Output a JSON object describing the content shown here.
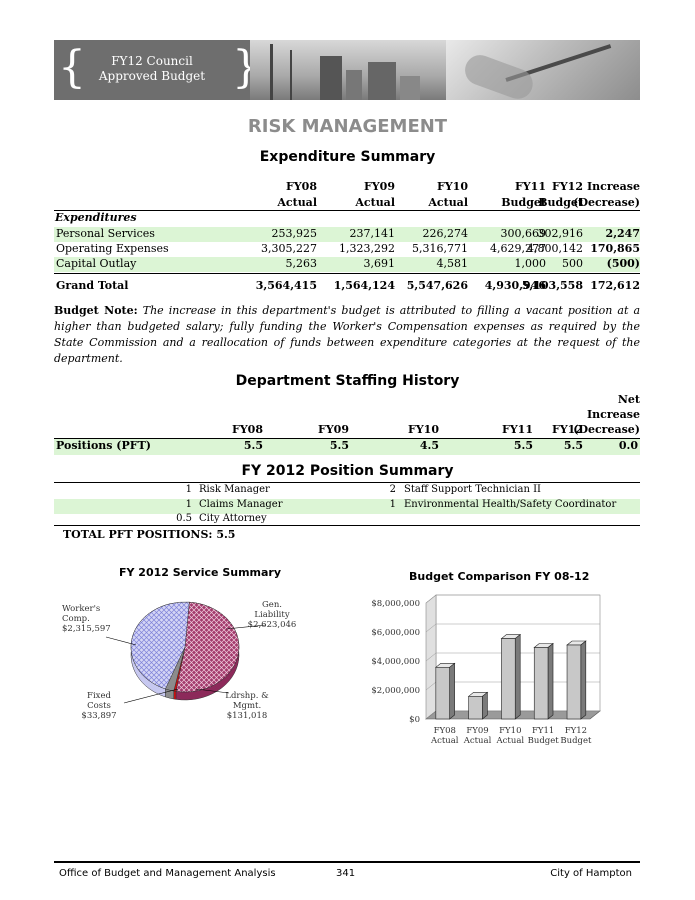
{
  "banner": {
    "line1": "FY12 Council",
    "line2": "Approved Budget"
  },
  "title": "RISK MANAGEMENT",
  "expenditure": {
    "heading": "Expenditure Summary",
    "columns": [
      {
        "line1": "FY08",
        "line2": "Actual"
      },
      {
        "line1": "FY09",
        "line2": "Actual"
      },
      {
        "line1": "FY10",
        "line2": "Actual"
      },
      {
        "line1": "FY11",
        "line2": "Budget"
      },
      {
        "line1": "FY12",
        "line2": "Budget"
      },
      {
        "line1": "Increase",
        "line2": "(Decrease)"
      }
    ],
    "section_label": "Expenditures",
    "rows": [
      {
        "label": "Personal Services",
        "values": [
          "253,925",
          "237,141",
          "226,274",
          "300,669",
          "302,916",
          "2,247"
        ]
      },
      {
        "label": "Operating Expenses",
        "values": [
          "3,305,227",
          "1,323,292",
          "5,316,771",
          "4,629,277",
          "4,800,142",
          "170,865"
        ]
      },
      {
        "label": "Capital Outlay",
        "values": [
          "5,263",
          "3,691",
          "4,581",
          "1,000",
          "500",
          "(500)"
        ]
      }
    ],
    "total": {
      "label": "Grand Total",
      "values": [
        "3,564,415",
        "1,564,124",
        "5,547,626",
        "4,930,946",
        "5,103,558",
        "172,612"
      ]
    }
  },
  "budget_note": {
    "label": "Budget Note:",
    "text": "The increase in this department's budget is attributed to filling a vacant position at a higher than budgeted salary; fully funding the Worker's Compensation expenses as required by the State Commission and a reallocation of funds between expenditure categories at the request of the department."
  },
  "staffing": {
    "heading": "Department Staffing History",
    "columns": [
      "FY08",
      "FY09",
      "FY10",
      "FY11",
      "FY12"
    ],
    "net_header": [
      "Net",
      "Increase",
      "(Decrease)"
    ],
    "row": {
      "label": "Positions (PFT)",
      "values": [
        "5.5",
        "5.5",
        "4.5",
        "5.5",
        "5.5",
        "0.0"
      ]
    }
  },
  "position_summary": {
    "heading": "FY 2012 Position Summary",
    "rows": [
      {
        "left_qty": "1",
        "left_title": "Risk Manager",
        "right_qty": "2",
        "right_title": "Staff Support Technician II"
      },
      {
        "left_qty": "1",
        "left_title": "Claims Manager",
        "right_qty": "1",
        "right_title": "Environmental Health/Safety Coordinator"
      },
      {
        "left_qty": "0.5",
        "left_title": "City Attorney",
        "right_qty": "",
        "right_title": ""
      }
    ],
    "total_label": "TOTAL PFT POSITIONS:",
    "total_value": "5.5"
  },
  "chart_data": [
    {
      "type": "pie",
      "title": "FY 2012 Service Summary",
      "slices": [
        {
          "label_lines": [
            "Worker's",
            "Comp.",
            "$2,315,597"
          ],
          "value": 2315597,
          "color": "#c7c8f0"
        },
        {
          "label_lines": [
            "Gen.",
            "Liability",
            "$2,623,046"
          ],
          "value": 2623046,
          "color": "#8c2a5a"
        },
        {
          "label_lines": [
            "Ldrshp. &",
            "Mgmt.",
            "$131,018"
          ],
          "value": 131018,
          "color": "#8c8c8c"
        },
        {
          "label_lines": [
            "Fixed",
            "Costs",
            "$33,897"
          ],
          "value": 33897,
          "color": "#d01010"
        }
      ]
    },
    {
      "type": "bar",
      "title": "Budget Comparison FY 08-12",
      "categories": [
        [
          "FY08",
          "Actual"
        ],
        [
          "FY09",
          "Actual"
        ],
        [
          "FY10",
          "Actual"
        ],
        [
          "FY11",
          "Budget"
        ],
        [
          "FY12",
          "Budget"
        ]
      ],
      "values": [
        3564415,
        1564124,
        5547626,
        4930946,
        5103558
      ],
      "yticks": [
        "$0",
        "$2,000,000",
        "$4,000,000",
        "$6,000,000",
        "$8,000,000"
      ],
      "ylim": [
        0,
        8000000
      ],
      "grid": true
    }
  ],
  "footer": {
    "left": "Office of Budget and Management Analysis",
    "center": "341",
    "right": "City of Hampton"
  }
}
